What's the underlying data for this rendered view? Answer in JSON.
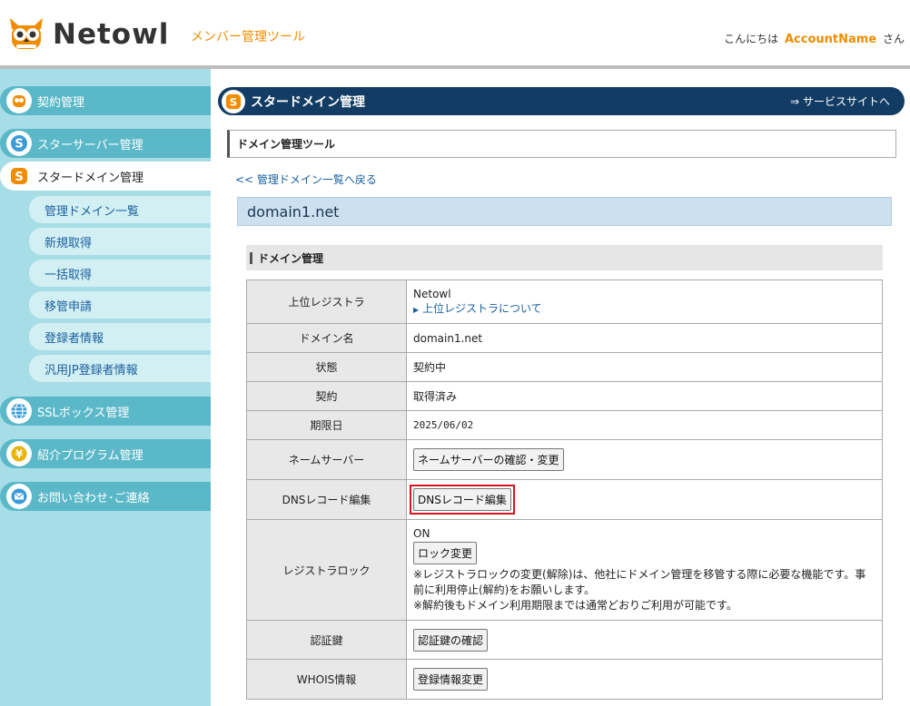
{
  "header": {
    "brand": "Netowl",
    "subtitle": "メンバー管理ツール",
    "greeting_prefix": "こんにちは",
    "account_name": "AccountName",
    "greeting_suffix": "さん"
  },
  "sidebar": {
    "items": [
      {
        "label": "契約管理",
        "icon": "owl-icon"
      },
      {
        "label": "スターサーバー管理",
        "icon": "star-server-icon"
      },
      {
        "label": "スタードメイン管理",
        "icon": "star-domain-icon",
        "active": true
      },
      {
        "label": "SSLボックス管理",
        "icon": "globe-icon"
      },
      {
        "label": "紹介プログラム管理",
        "icon": "yen-icon"
      },
      {
        "label": "お問い合わせ･ご連絡",
        "icon": "mail-icon"
      }
    ],
    "subitems": [
      "管理ドメイン一覧",
      "新規取得",
      "一括取得",
      "移管申請",
      "登録者情報",
      "汎用JP登録者情報"
    ]
  },
  "page": {
    "title": "スタードメイン管理",
    "service_link": "⇒ サービスサイトへ",
    "tool_title": "ドメイン管理ツール",
    "back_link": "<< 管理ドメイン一覧へ戻る",
    "domain": "domain1.net",
    "section_title": "ドメイン管理"
  },
  "table": {
    "registrar_label": "上位レジストラ",
    "registrar_value": "Netowl",
    "registrar_link": "上位レジストラについて",
    "domain_label": "ドメイン名",
    "domain_value": "domain1.net",
    "status_label": "状態",
    "status_value": "契約中",
    "contract_label": "契約",
    "contract_value": "取得済み",
    "expiry_label": "期限日",
    "expiry_value": "2025/06/02",
    "ns_label": "ネームサーバー",
    "ns_button": "ネームサーバーの確認・変更",
    "dns_label": "DNSレコード編集",
    "dns_button": "DNSレコード編集",
    "lock_label": "レジストラロック",
    "lock_value": "ON",
    "lock_button": "ロック変更",
    "lock_note1": "※レジストラロックの変更(解除)は、他社にドメイン管理を移管する際に必要な機能です。事前に利用停止(解約)をお願いします。",
    "lock_note2": "※解約後もドメイン利用期限までは通常どおりご利用が可能です。",
    "auth_label": "認証鍵",
    "auth_button": "認証鍵の確認",
    "whois_label": "WHOIS情報",
    "whois_button": "登録情報変更"
  },
  "colors": {
    "accent": "#f08c00",
    "navy": "#133c64",
    "sidebar_bg": "#a6dde6",
    "highlight": "#d8141e"
  }
}
